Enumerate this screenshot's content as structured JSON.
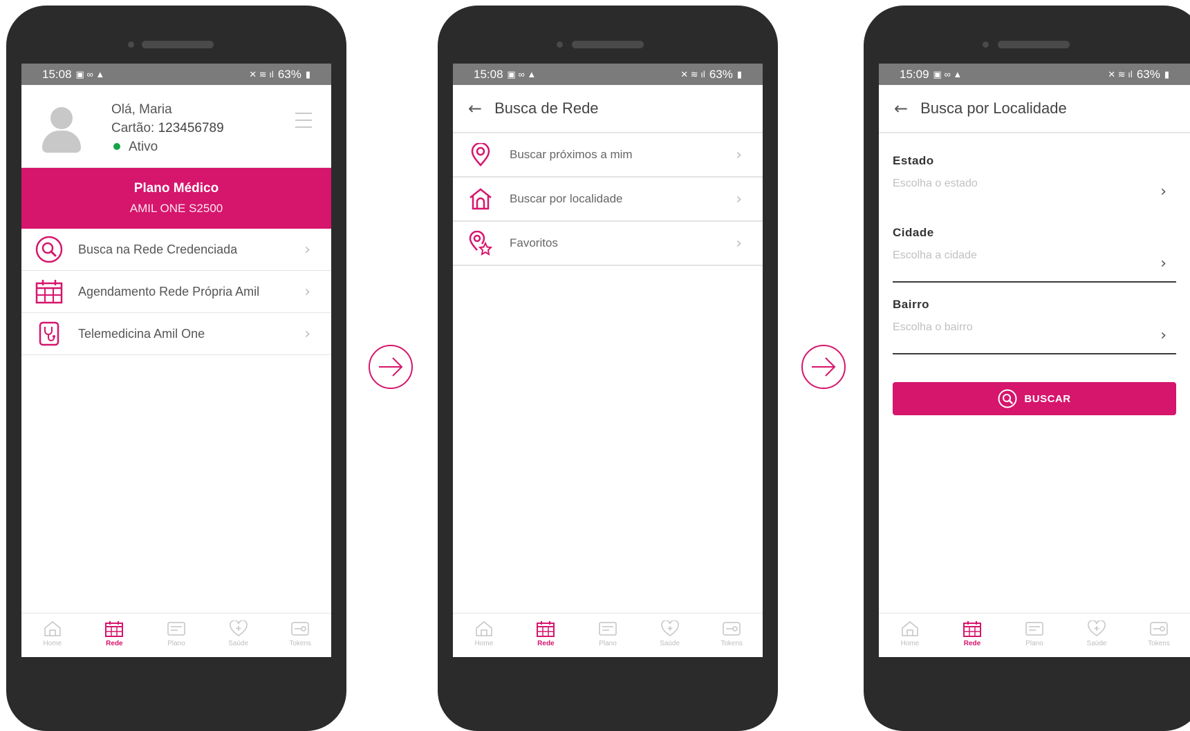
{
  "colors": {
    "brand": "#d6156c",
    "active_dot": "#18a348"
  },
  "statusbar": [
    {
      "time": "15:08",
      "left_icons": "▣ ∞ ▲",
      "right": "63%"
    },
    {
      "time": "15:08",
      "left_icons": "▣ ∞ ▲",
      "right": "63%"
    },
    {
      "time": "15:09",
      "left_icons": "▣ ∞ ▲",
      "right": "63%"
    }
  ],
  "screen1": {
    "greeting": "Olá, Maria",
    "card_label": "Cartão:",
    "card_number": "123456789",
    "status": "Ativo",
    "plan_title": "Plano Médico",
    "plan_name": "AMIL ONE S2500",
    "menu": [
      {
        "label": "Busca na Rede Credenciada",
        "icon": "search-icon"
      },
      {
        "label": "Agendamento Rede Própria Amil",
        "icon": "calendar-icon"
      },
      {
        "label": "Telemedicina Amil One",
        "icon": "stethoscope-icon"
      }
    ]
  },
  "screen2": {
    "title": "Busca de Rede",
    "items": [
      {
        "label": "Buscar próximos a mim",
        "icon": "location-pin-icon"
      },
      {
        "label": "Buscar por localidade",
        "icon": "home-icon"
      },
      {
        "label": "Favoritos",
        "icon": "favorite-badge-icon"
      }
    ]
  },
  "screen3": {
    "title": "Busca por Localidade",
    "fields": [
      {
        "label": "Estado",
        "placeholder": "Escolha o estado"
      },
      {
        "label": "Cidade",
        "placeholder": "Escolha a cidade"
      },
      {
        "label": "Bairro",
        "placeholder": "Escolha o bairro"
      }
    ],
    "button": "BUSCAR"
  },
  "nav": [
    {
      "label": "Home",
      "icon": "home-icon"
    },
    {
      "label": "Rede",
      "icon": "calendar-icon"
    },
    {
      "label": "Plano",
      "icon": "card-icon"
    },
    {
      "label": "Saúde",
      "icon": "heart-plus-icon"
    },
    {
      "label": "Tokens",
      "icon": "key-icon"
    }
  ],
  "active_nav": "Rede"
}
